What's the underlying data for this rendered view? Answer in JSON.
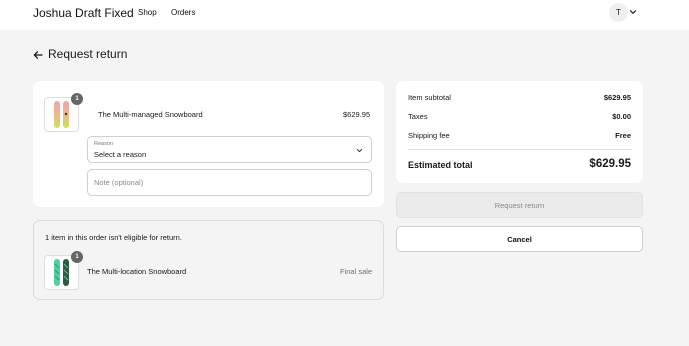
{
  "header": {
    "store_name": "Joshua Draft Fixed",
    "nav": [
      "Shop",
      "Orders"
    ],
    "avatar_initial": "T"
  },
  "page": {
    "title": "Request return"
  },
  "return_item": {
    "title": "The Multi-managed Snowboard",
    "price": "$629.95",
    "quantity_badge": "1",
    "reason_label": "Reason",
    "reason_value": "Select a reason",
    "note_placeholder": "Note (optional)"
  },
  "ineligible": {
    "message": "1 item in this order isn't eligible for return.",
    "item_title": "The Multi-location Snowboard",
    "quantity_badge": "1",
    "status": "Final sale"
  },
  "summary": {
    "subtotal_label": "Item subtotal",
    "subtotal_value": "$629.95",
    "taxes_label": "Taxes",
    "taxes_value": "$0.00",
    "shipping_label": "Shipping fee",
    "shipping_value": "Free",
    "total_label": "Estimated total",
    "total_value": "$629.95"
  },
  "buttons": {
    "request_return": "Request return",
    "cancel": "Cancel"
  },
  "icons": {
    "back": "arrow-left-icon",
    "avatar_menu": "chevron-down-icon",
    "select": "chevron-down-icon"
  }
}
